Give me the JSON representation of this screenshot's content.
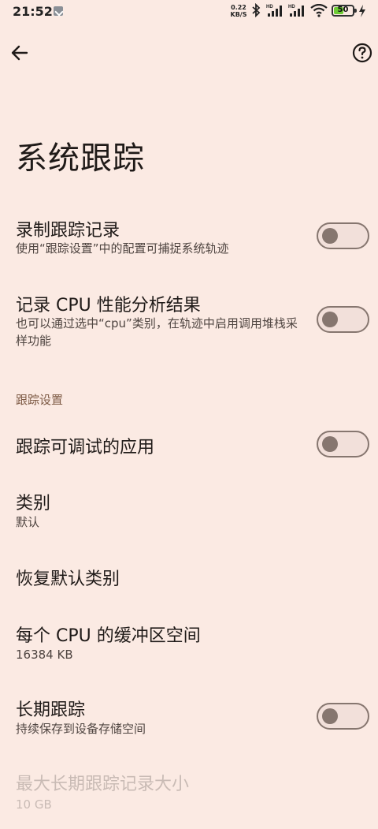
{
  "status_bar": {
    "time": "21:52",
    "net_speed_value": "0.22",
    "net_speed_unit": "KB/S",
    "battery": "50"
  },
  "app_bar": {
    "back_icon": "arrow-left-icon",
    "help_icon": "help-circle-icon"
  },
  "page": {
    "title": "系统跟踪"
  },
  "settings": {
    "record_trace": {
      "title": "录制跟踪记录",
      "subtitle": "使用“跟踪设置”中的配置可捕捉系统轨迹",
      "enabled": false
    },
    "record_cpu_profile": {
      "title": "记录 CPU 性能分析结果",
      "subtitle": "也可以通过选中“cpu”类别，在轨迹中启用调用堆栈采样功能",
      "enabled": false
    },
    "section_header": "跟踪设置",
    "trace_debuggable_apps": {
      "title": "跟踪可调试的应用",
      "enabled": false
    },
    "categories": {
      "title": "类别",
      "subtitle": "默认"
    },
    "restore_default_categories": {
      "title": "恢复默认类别"
    },
    "buffer_size_per_cpu": {
      "title": "每个 CPU 的缓冲区空间",
      "subtitle": "16384 KB"
    },
    "long_traces": {
      "title": "长期跟踪",
      "subtitle": "持续保存到设备存储空间",
      "enabled": false
    },
    "max_long_trace_size": {
      "title": "最大长期跟踪记录大小",
      "subtitle": "10 GB"
    }
  },
  "colors": {
    "background": "#fbeae3",
    "switch_track": "#f2e0da",
    "switch_outline": "#86766f",
    "section_header": "#7d5a44"
  }
}
